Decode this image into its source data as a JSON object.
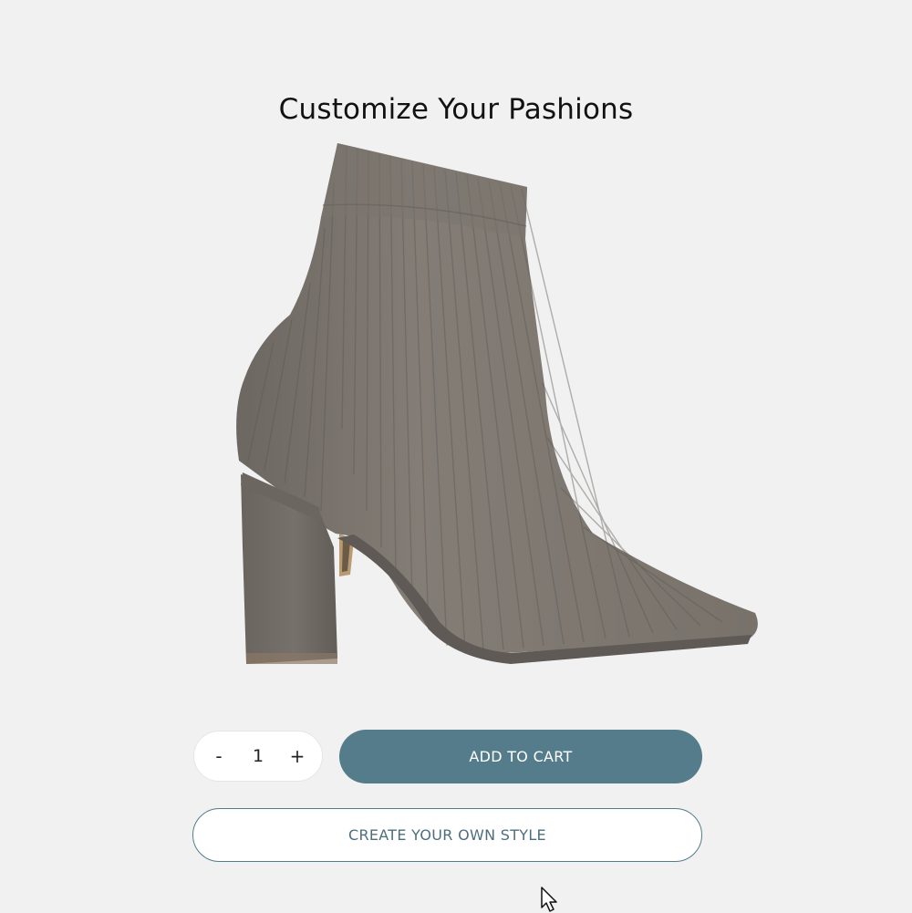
{
  "header": {
    "title": "Customize Your Pashions"
  },
  "product": {
    "image_icon": "ankle-boot-image",
    "colors": {
      "boot": "#7b756e",
      "heel": "#6f6963",
      "sole": "#5f5a56"
    }
  },
  "quantity": {
    "minus_label": "-",
    "value": "1",
    "plus_label": "+"
  },
  "actions": {
    "add_to_cart_label": "ADD TO CART",
    "create_style_label": "CREATE YOUR OWN STYLE"
  },
  "theme": {
    "accent": "#557c8b",
    "background": "#f1f1f1"
  }
}
